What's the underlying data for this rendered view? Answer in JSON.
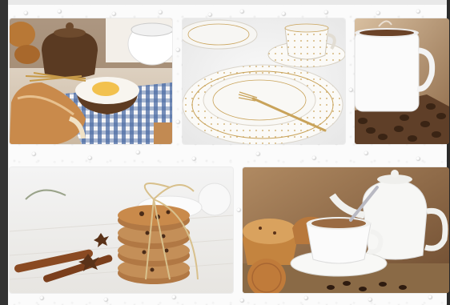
{
  "tiles": [
    {
      "name": "bakery-tile",
      "subject": "bread-flour-pot-photo"
    },
    {
      "name": "tableware-tile",
      "subject": "white-plates-teacup-photo"
    },
    {
      "name": "coffee-cup-tile",
      "subject": "coffee-mug-beans-photo"
    },
    {
      "name": "cookies-tile",
      "subject": "cookie-stack-cinnamon-photo"
    },
    {
      "name": "teapot-tile",
      "subject": "teapot-muffin-coffee-photo"
    }
  ],
  "colors": {
    "background": "#fbfbfb",
    "frame_dark": "#333333",
    "bread": "#c98a4b",
    "flour_yolk": "#f2c14e",
    "cloth_blue": "#3c5f96",
    "plate_white": "#f4f2ee",
    "gold": "#c9a35a",
    "coffee_brown": "#6b4328",
    "bean_dark": "#3a2414",
    "cookie": "#b98552",
    "cinnamon": "#8a4a22",
    "warm_backdrop": "#9c7450"
  }
}
